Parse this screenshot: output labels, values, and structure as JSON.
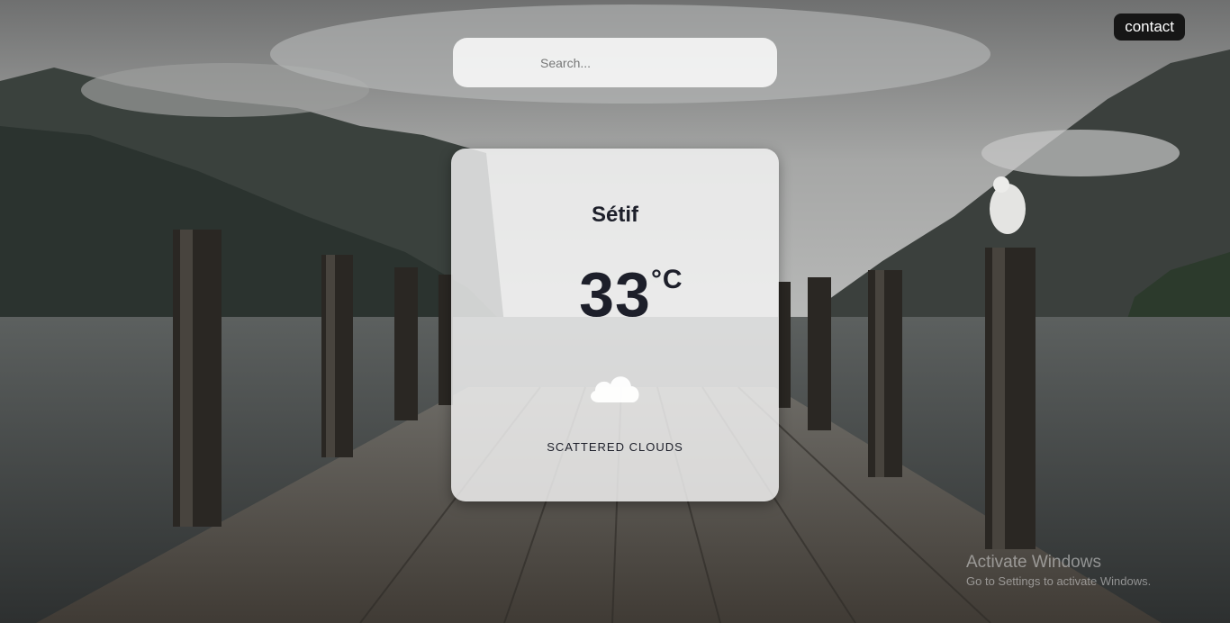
{
  "header": {
    "contact_label": "contact"
  },
  "search": {
    "placeholder": "Search...",
    "value": ""
  },
  "weather": {
    "city": "Sétif",
    "temperature": "33",
    "unit": "°C",
    "condition": "SCATTERED CLOUDS",
    "icon": "cloud-icon"
  },
  "watermark": {
    "title": "Activate Windows",
    "subtitle": "Go to Settings to activate Windows."
  },
  "colors": {
    "flag_accent": "#f59a12",
    "text_dark": "#1d1f2a",
    "button_bg": "#161616"
  }
}
